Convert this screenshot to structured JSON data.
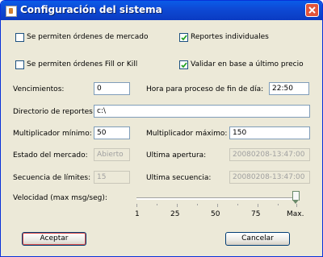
{
  "window": {
    "title": "Configuración del sistema"
  },
  "options": {
    "market_orders": {
      "label": "Se permiten órdenes de mercado",
      "checked": false
    },
    "individual_reports": {
      "label": "Reportes individuales",
      "checked": true
    },
    "fill_or_kill": {
      "label": "Se permiten órdenes Fill or Kill",
      "checked": false
    },
    "validate_last_price": {
      "label": "Validar en base a último precio",
      "checked": true
    }
  },
  "fields": {
    "vencimientos": {
      "label": "Vencimientos:",
      "value": "0"
    },
    "hora_fin_dia": {
      "label": "Hora para proceso de fin de día:",
      "value": "22:50"
    },
    "directorio": {
      "label": "Directorio de reportes:",
      "value": "c:\\"
    },
    "mult_min": {
      "label": "Multiplicador mínimo:",
      "value": "50"
    },
    "mult_max": {
      "label": "Multiplicador máximo:",
      "value": "150"
    },
    "estado_mercado": {
      "label": "Estado del mercado:",
      "value": "Abierto"
    },
    "ultima_apertura": {
      "label": "Ultima apertura:",
      "value": "20080208-13:47:00"
    },
    "secuencia_limites": {
      "label": "Secuencia de límites:",
      "value": "15"
    },
    "ultima_secuencia": {
      "label": "Ultima secuencia:",
      "value": "20080208-13:47:00"
    }
  },
  "velocidad": {
    "label": "Velocidad (max msg/seg):",
    "ticks": [
      "1",
      "25",
      "50",
      "75",
      "Max."
    ],
    "value": "Max."
  },
  "buttons": {
    "accept": "Aceptar",
    "cancel": "Cancelar"
  }
}
